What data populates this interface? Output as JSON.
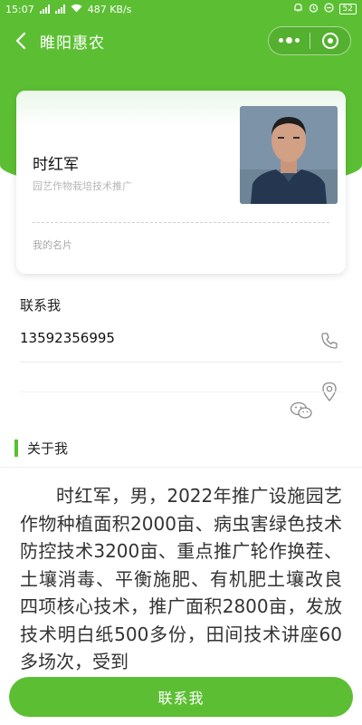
{
  "status_bar": {
    "time": "15:07",
    "network_speed": "487 KB/s",
    "battery": "52"
  },
  "header": {
    "title": "睢阳惠农"
  },
  "profile_card": {
    "name": "时红军",
    "job_title": "园艺作物栽培技术推广",
    "card_label": "我的名片"
  },
  "contact": {
    "section_title": "联系我",
    "phone": "13592356995"
  },
  "about": {
    "section_title": "关于我",
    "body": "时红军，男，2022年推广设施园艺作物种植面积2000亩、病虫害绿色技术防控技术3200亩、重点推广轮作换茬、土壤消毒、平衡施肥、有机肥土壤改良四项核心技术，推广面积2800亩，发放技术明白纸500多份，田间技术讲座60多场次，受到"
  },
  "footer": {
    "contact_button_label": "联系我"
  },
  "colors": {
    "brand_green": "#5cbf33",
    "muted_text": "#b5b5b5"
  },
  "icons": {
    "back": "back-arrow-icon",
    "more": "more-dots-icon",
    "close": "capsule-close-icon",
    "phone": "phone-icon",
    "location": "location-pin-icon",
    "wechat": "wechat-icon"
  }
}
